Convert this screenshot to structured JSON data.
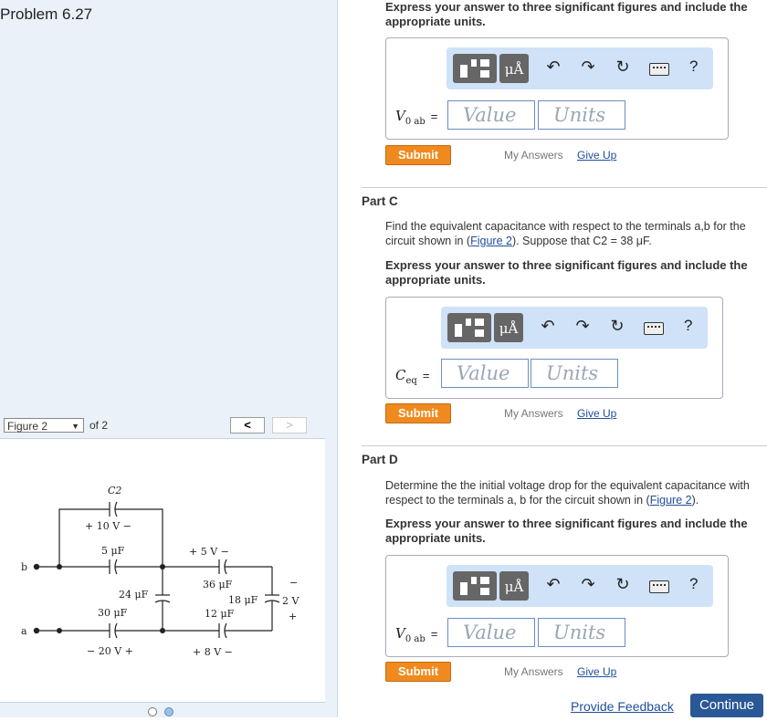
{
  "left": {
    "problem_title": "Problem 6.27",
    "figure_select": "Figure 2",
    "figure_of": "of 2",
    "prev_label": "<",
    "next_label": ">",
    "circuit": {
      "c2": "C2",
      "v10": "+ 10 V −",
      "c5": "5 μF",
      "c24": "24 μF",
      "c30": "30 μF",
      "v20": "− 20 V +",
      "v5": "+ 5 V −",
      "c36": "36 μF",
      "c18": "18 μF",
      "v2": "2 V",
      "c12": "12 μF",
      "v8": "+ 8 V −",
      "node_b": "b",
      "node_a": "a",
      "minus": "−",
      "plus": "+"
    }
  },
  "top": {
    "instruction": "Express your answer to three significant figures and include the appropriate units.",
    "var_main": "V",
    "var_sub": "0 ab",
    "eq": "=",
    "value_placeholder": "Value",
    "units_placeholder": "Units",
    "submit": "Submit",
    "my_answers": "My Answers",
    "give_up": "Give Up"
  },
  "part_c": {
    "title": "Part C",
    "text_pre": "Find the equivalent capacitance with respect to the terminals a,b for the circuit shown in (",
    "figure_link": "Figure 2",
    "text_post": "). Suppose that C2 = 38 μF.",
    "instruction": "Express your answer to three significant figures and include the appropriate units.",
    "var_main": "C",
    "var_sub": "eq",
    "eq": "=",
    "value_placeholder": "Value",
    "units_placeholder": "Units",
    "submit": "Submit",
    "my_answers": "My Answers",
    "give_up": "Give Up"
  },
  "part_d": {
    "title": "Part D",
    "text_pre": "Determine the the initial voltage drop for the equivalent capacitance with respect to the terminals a, b for the circuit shown in (",
    "figure_link": "Figure 2",
    "text_post": ").",
    "instruction": "Express your answer to three significant figures and include the appropriate units.",
    "var_main": "V",
    "var_sub": "0 ab",
    "eq": "=",
    "value_placeholder": "Value",
    "units_placeholder": "Units",
    "submit": "Submit",
    "my_answers": "My Answers",
    "give_up": "Give Up"
  },
  "toolbar": {
    "units_button": "μÅ",
    "help": "?",
    "icons": [
      "templates-icon",
      "units-icon",
      "undo-icon",
      "redo-icon",
      "reset-icon",
      "keyboard-icon",
      "help-icon"
    ]
  },
  "footer": {
    "provide_feedback": "Provide Feedback",
    "continue": "Continue"
  }
}
